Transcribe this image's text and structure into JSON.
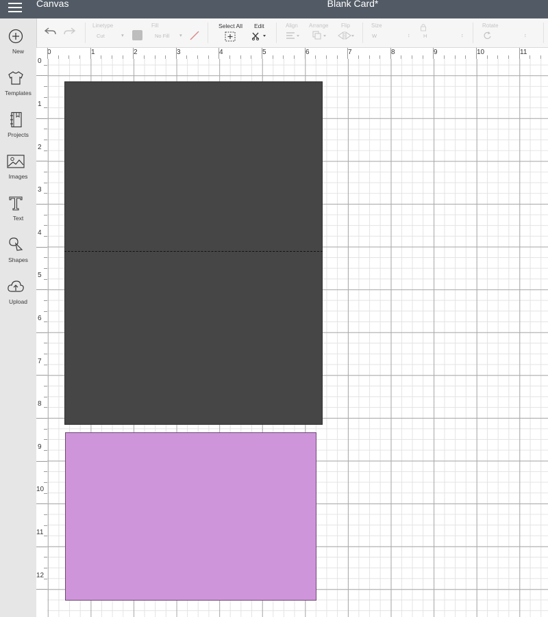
{
  "topbar": {
    "app_title": "Canvas",
    "doc_title": "Blank Card*"
  },
  "toolbar": {
    "linetype": {
      "label": "Linetype",
      "value": "Cut"
    },
    "fill": {
      "label": "Fill",
      "value": "No Fill"
    },
    "select_all": {
      "label": "Select All"
    },
    "edit": {
      "label": "Edit"
    },
    "align": {
      "label": "Align"
    },
    "arrange": {
      "label": "Arrange"
    },
    "flip": {
      "label": "Flip"
    },
    "size": {
      "label": "Size",
      "w": "W",
      "h": "H"
    },
    "rotate": {
      "label": "Rotate"
    }
  },
  "sidebar": {
    "items": [
      {
        "label": "New",
        "icon": "plus-circle-icon"
      },
      {
        "label": "Templates",
        "icon": "tshirt-icon"
      },
      {
        "label": "Projects",
        "icon": "notebook-icon"
      },
      {
        "label": "Images",
        "icon": "image-icon"
      },
      {
        "label": "Text",
        "icon": "text-t-icon"
      },
      {
        "label": "Shapes",
        "icon": "shapes-icon"
      },
      {
        "label": "Upload",
        "icon": "cloud-upload-icon"
      }
    ]
  },
  "ruler": {
    "top": [
      "0",
      "1",
      "2",
      "3",
      "4",
      "5",
      "6",
      "7",
      "8",
      "9",
      "10",
      "11"
    ],
    "left": [
      "0",
      "1",
      "2",
      "3",
      "4",
      "5",
      "6",
      "7",
      "8",
      "9",
      "10",
      "11",
      "12"
    ]
  },
  "canvas": {
    "shapes": [
      {
        "name": "card-base",
        "color": "#464646"
      },
      {
        "name": "card-insert",
        "color": "#cf95da"
      }
    ],
    "score_line_color": "#111111"
  }
}
